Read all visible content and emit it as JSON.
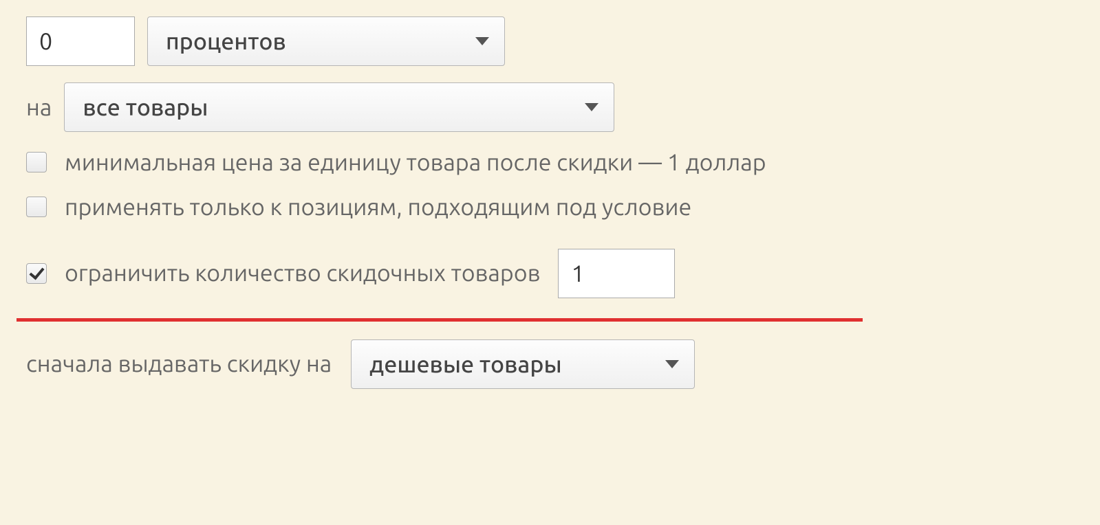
{
  "discount": {
    "amount": "0",
    "unit_selected": "процентов"
  },
  "scope": {
    "prefix": "на",
    "selected": "все товары"
  },
  "options": {
    "min_price": {
      "checked": false,
      "label": "минимальная цена за единицу товара после скидки — 1 доллар"
    },
    "apply_matching": {
      "checked": false,
      "label": "применять только к позициям, подходящим под условие"
    },
    "limit_count": {
      "checked": true,
      "label": "ограничить количество скидочных товаров",
      "value": "1"
    }
  },
  "priority": {
    "prefix": "сначала выдавать скидку на",
    "selected": "дешевые товары"
  }
}
